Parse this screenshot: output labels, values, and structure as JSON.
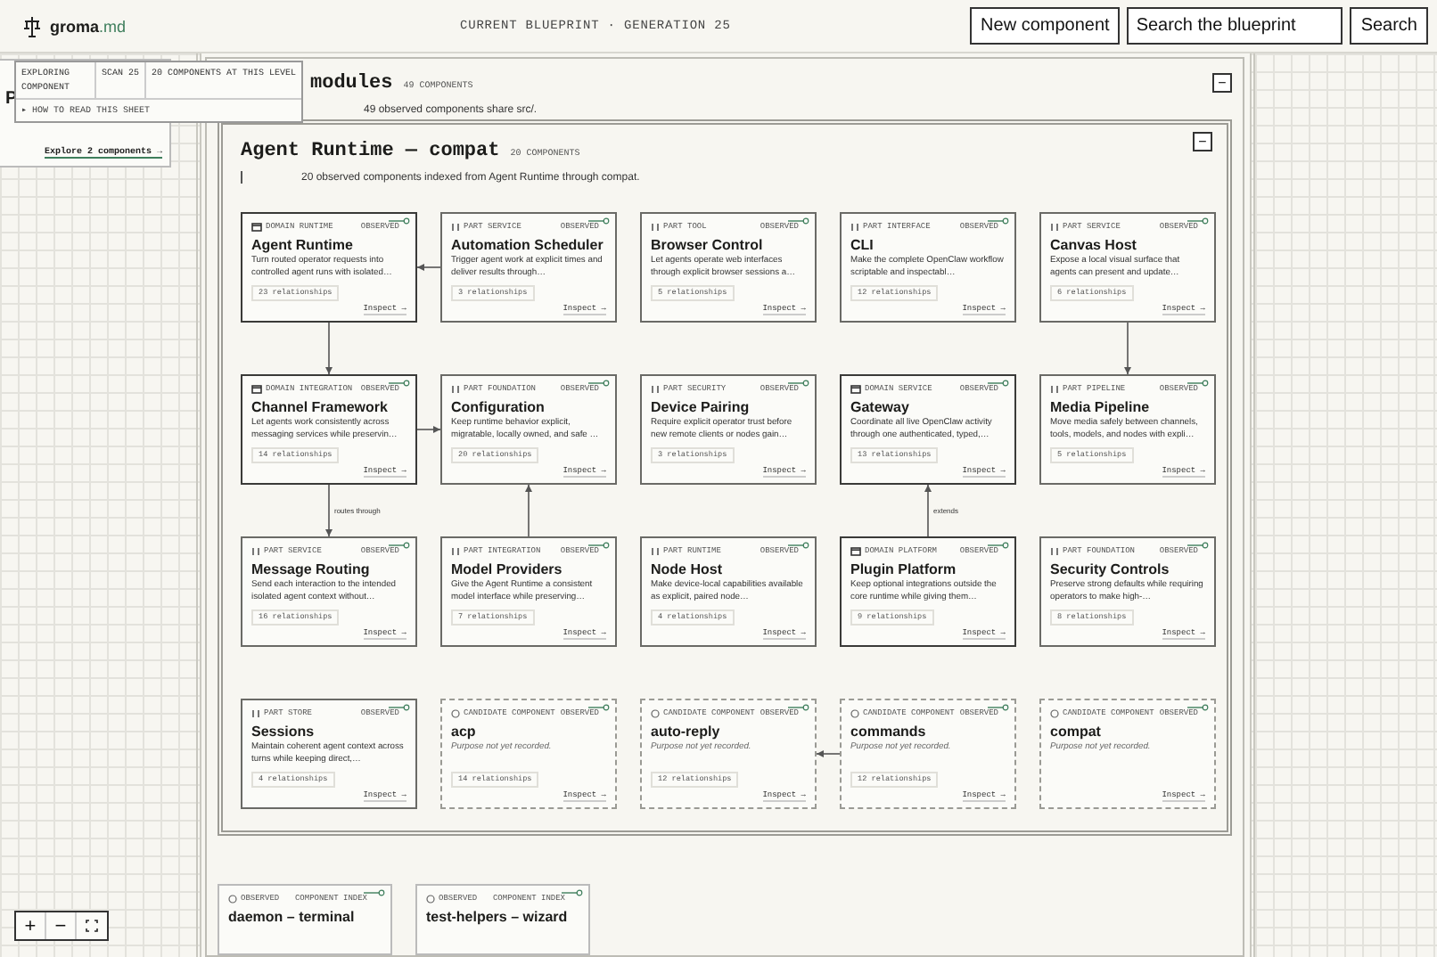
{
  "app_bar": {
    "brand": "groma",
    "brand_suffix": ".md",
    "title": "CURRENT BLUEPRINT · GENERATION 25",
    "new_button": "New component",
    "search": {
      "placeholder": "Search the blueprint"
    },
    "search_button": "Search"
  },
  "side_card": {
    "title": "P",
    "link": "Explore 2 components →"
  },
  "popover": {
    "cells": [
      "EXPLORING COMPONENT",
      "SCAN 25",
      "20 COMPONENTS AT THIS LEVEL"
    ],
    "link": "▸ HOW TO READ THIS SHEET"
  },
  "zoom_controls": [
    "+",
    "−"
  ],
  "modules": {
    "title": "modules",
    "count": "49 COMPONENTS",
    "description": "49 observed components share src/.",
    "collapse": "−"
  },
  "group": {
    "title": "Agent Runtime — compat",
    "count": "20 COMPONENTS",
    "description": "20 observed components indexed from Agent Runtime through compat.",
    "collapse": "−",
    "cards": [
      {
        "kind": "domain",
        "tag": "DOMAIN RUNTIME",
        "status": "OBSERVED",
        "title": "Agent Runtime",
        "description": "Turn routed operator requests into controlled agent runs with isolated…",
        "relationships": "23 relationships",
        "action": "Inspect →",
        "links": [
          {
            "kind": "down"
          }
        ]
      },
      {
        "kind": "part",
        "tag": "PART SERVICE",
        "status": "OBSERVED",
        "title": "Automation Scheduler",
        "description": "Trigger agent work at explicit times and deliver results through…",
        "relationships": "3 relationships",
        "action": "Inspect →",
        "links": [
          {
            "kind": "left"
          }
        ]
      },
      {
        "kind": "part",
        "tag": "PART TOOL",
        "status": "OBSERVED",
        "title": "Browser Control",
        "description": "Let agents operate web interfaces through explicit browser sessions a…",
        "relationships": "5 relationships",
        "action": "Inspect →"
      },
      {
        "kind": "part",
        "tag": "PART INTERFACE",
        "status": "OBSERVED",
        "title": "CLI",
        "description": "Make the complete OpenClaw workflow scriptable and inspectabl…",
        "relationships": "12 relationships",
        "action": "Inspect →"
      },
      {
        "kind": "part",
        "tag": "PART SERVICE",
        "status": "OBSERVED",
        "title": "Canvas Host",
        "description": "Expose a local visual surface that agents can present and update…",
        "relationships": "6 relationships",
        "action": "Inspect →",
        "links": [
          {
            "kind": "down"
          }
        ]
      },
      {
        "kind": "domain",
        "tag": "DOMAIN INTEGRATION",
        "status": "OBSERVED",
        "title": "Channel Framework",
        "description": "Let agents work consistently across messaging services while preservin…",
        "relationships": "14 relationships",
        "action": "Inspect →",
        "links": [
          {
            "kind": "right"
          },
          {
            "kind": "down",
            "label": "routes through"
          }
        ]
      },
      {
        "kind": "part",
        "tag": "PART FOUNDATION",
        "status": "OBSERVED",
        "title": "Configuration",
        "description": "Keep runtime behavior explicit, migratable, locally owned, and safe …",
        "relationships": "20 relationships",
        "action": "Inspect →"
      },
      {
        "kind": "part",
        "tag": "PART SECURITY",
        "status": "OBSERVED",
        "title": "Device Pairing",
        "description": "Require explicit operator trust before new remote clients or nodes gain…",
        "relationships": "3 relationships",
        "action": "Inspect →"
      },
      {
        "kind": "domain",
        "tag": "DOMAIN SERVICE",
        "status": "OBSERVED",
        "title": "Gateway",
        "description": "Coordinate all live OpenClaw activity through one authenticated, typed,…",
        "relationships": "13 relationships",
        "action": "Inspect →"
      },
      {
        "kind": "part",
        "tag": "PART PIPELINE",
        "status": "OBSERVED",
        "title": "Media Pipeline",
        "description": "Move media safely between channels, tools, models, and nodes with expli…",
        "relationships": "5 relationships",
        "action": "Inspect →"
      },
      {
        "kind": "part",
        "tag": "PART SERVICE",
        "status": "OBSERVED",
        "title": "Message Routing",
        "description": "Send each interaction to the intended isolated agent context without…",
        "relationships": "16 relationships",
        "action": "Inspect →"
      },
      {
        "kind": "part",
        "tag": "PART INTEGRATION",
        "status": "OBSERVED",
        "title": "Model Providers",
        "description": "Give the Agent Runtime a consistent model interface while preserving…",
        "relationships": "7 relationships",
        "action": "Inspect →",
        "links": [
          {
            "kind": "up"
          }
        ]
      },
      {
        "kind": "part",
        "tag": "PART RUNTIME",
        "status": "OBSERVED",
        "title": "Node Host",
        "description": "Make device-local capabilities available as explicit, paired node…",
        "relationships": "4 relationships",
        "action": "Inspect →"
      },
      {
        "kind": "domain",
        "tag": "DOMAIN PLATFORM",
        "status": "OBSERVED",
        "title": "Plugin Platform",
        "description": "Keep optional integrations outside the core runtime while giving them…",
        "relationships": "9 relationships",
        "action": "Inspect →",
        "links": [
          {
            "kind": "up",
            "label": "extends"
          }
        ]
      },
      {
        "kind": "part",
        "tag": "PART FOUNDATION",
        "status": "OBSERVED",
        "title": "Security Controls",
        "description": "Preserve strong defaults while requiring operators to make high-…",
        "relationships": "8 relationships",
        "action": "Inspect →"
      },
      {
        "kind": "part",
        "tag": "PART STORE",
        "status": "OBSERVED",
        "title": "Sessions",
        "description": "Maintain coherent agent context across turns while keeping direct,…",
        "relationships": "4 relationships",
        "action": "Inspect →"
      },
      {
        "kind": "candidate",
        "tag": "CANDIDATE COMPONENT",
        "status": "OBSERVED",
        "title": "acp",
        "description": "Purpose not yet recorded.",
        "relationships": "14 relationships",
        "action": "Inspect →"
      },
      {
        "kind": "candidate",
        "tag": "CANDIDATE COMPONENT",
        "status": "OBSERVED",
        "title": "auto-reply",
        "description": "Purpose not yet recorded.",
        "relationships": "12 relationships",
        "action": "Inspect →"
      },
      {
        "kind": "candidate",
        "tag": "CANDIDATE COMPONENT",
        "status": "OBSERVED",
        "title": "commands",
        "description": "Purpose not yet recorded.",
        "relationships": "12 relationships",
        "action": "Inspect →",
        "links": [
          {
            "kind": "left"
          }
        ]
      },
      {
        "kind": "candidate",
        "tag": "CANDIDATE COMPONENT",
        "status": "OBSERVED",
        "title": "compat",
        "description": "Purpose not yet recorded.",
        "action": "Inspect →"
      }
    ]
  },
  "index_cards": [
    {
      "status": "OBSERVED",
      "tag": "COMPONENT INDEX",
      "title": "daemon – terminal"
    },
    {
      "status": "OBSERVED",
      "tag": "COMPONENT INDEX",
      "title": "test-helpers – wizard"
    }
  ]
}
